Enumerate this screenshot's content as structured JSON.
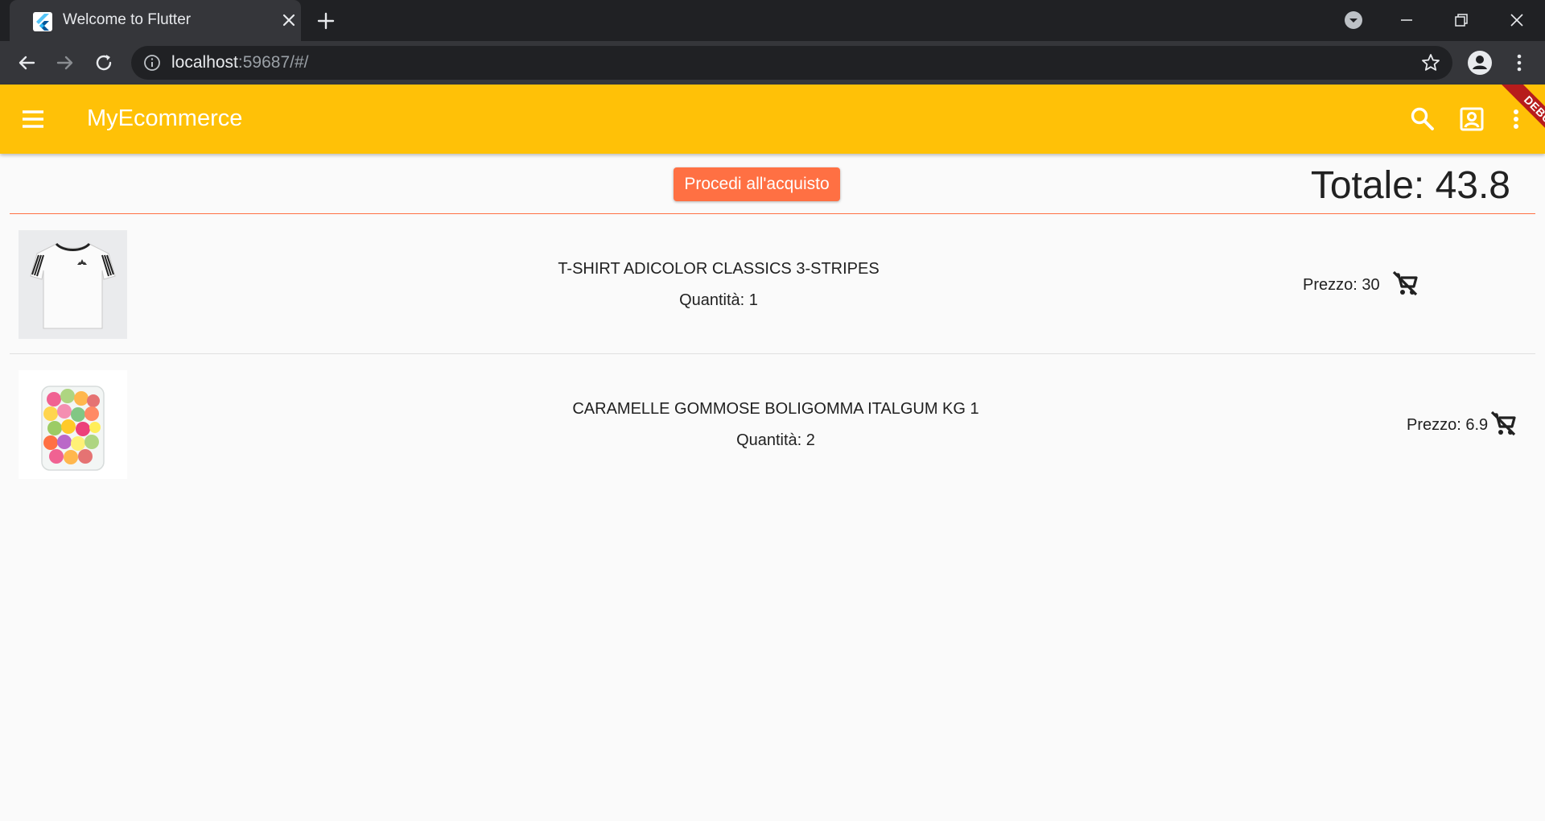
{
  "browser": {
    "tab_title": "Welcome to Flutter",
    "url_host": "localhost",
    "url_rest": ":59687/#/"
  },
  "app": {
    "title": "MyEcommerce",
    "debug_label": "DEBUG",
    "accent_color": "#ffc107",
    "button_color": "#ff7043"
  },
  "cart": {
    "checkout_label": "Procedi all'acquisto",
    "total_label": "Totale: 43.8",
    "items": [
      {
        "name": "T-SHIRT ADICOLOR CLASSICS 3-STRIPES",
        "quantity": "Quantità: 1",
        "price": "Prezzo: 30",
        "image": "white-tshirt"
      },
      {
        "name": "CARAMELLE GOMMOSE BOLIGOMMA ITALGUM KG 1",
        "quantity": "Quantità: 2",
        "price": "Prezzo: 6.9",
        "image": "gummy-candy-jar"
      }
    ]
  }
}
